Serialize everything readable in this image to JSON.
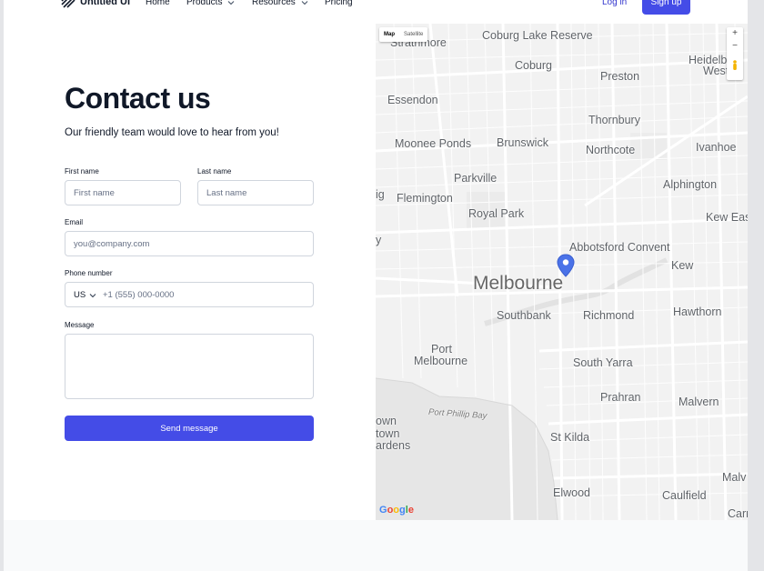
{
  "nav": {
    "logo_text": "Untitled UI",
    "items": [
      {
        "label": "Home"
      },
      {
        "label": "Products"
      },
      {
        "label": "Resources"
      },
      {
        "label": "Pricing"
      }
    ],
    "login_label": "Log in",
    "signup_label": "Sign up"
  },
  "contact": {
    "title": "Contact us",
    "subtitle": "Our friendly team would love to hear from you!",
    "first_name": {
      "label": "First name",
      "placeholder": "First name",
      "value": ""
    },
    "last_name": {
      "label": "Last name",
      "placeholder": "Last name",
      "value": ""
    },
    "email": {
      "label": "Email",
      "placeholder": "you@company.com",
      "value": ""
    },
    "phone": {
      "label": "Phone number",
      "country": "US",
      "placeholder": "+1 (555) 000-0000",
      "value": ""
    },
    "message": {
      "label": "Message",
      "value": ""
    },
    "submit_label": "Send message"
  },
  "map": {
    "type_control": {
      "map_label": "Map",
      "satellite_label": "Satellite",
      "selected": "Map"
    },
    "zoom_in": "+",
    "zoom_out": "−",
    "google_logo": "Google",
    "places": {
      "strathmore": "Strathmore",
      "coburg_lake": "Coburg Lake Reserve",
      "heidelberg": "Heidelbe",
      "heidelberg2": "West",
      "coburg": "Coburg",
      "preston": "Preston",
      "essendon": "Essendon",
      "thornbury": "Thornbury",
      "moonee_ponds": "Moonee Ponds",
      "brunswick": "Brunswick",
      "northcote": "Northcote",
      "ivanhoe": "Ivanhoe",
      "parkville": "Parkville",
      "alphington": "Alphington",
      "flemington": "Flemington",
      "flemington_prefix": "ig",
      "royal_park": "Royal Park",
      "kew_east": "Kew Eas",
      "y_edge": "y",
      "abbotsford": "Abbotsford Convent",
      "kew": "Kew",
      "melbourne": "Melbourne",
      "southbank": "Southbank",
      "richmond": "Richmond",
      "hawthorn": "Hawthorn",
      "port_melbourne_1": "Port",
      "port_melbourne_2": "Melbourne",
      "south_yarra": "South Yarra",
      "prahran": "Prahran",
      "malvern": "Malvern",
      "port_phillip_bay": "Port Phillip Bay",
      "wn": "own",
      "town": "town",
      "ardens": "ardens",
      "st_kilda": "St Kilda",
      "malv": "Malv",
      "elwood": "Elwood",
      "caulfield": "Caulfield",
      "carr": "Carr"
    },
    "pin_color": "#4a72e8"
  },
  "colors": {
    "brand": "#444ce7",
    "link": "#3538cd",
    "text": "#101828"
  }
}
